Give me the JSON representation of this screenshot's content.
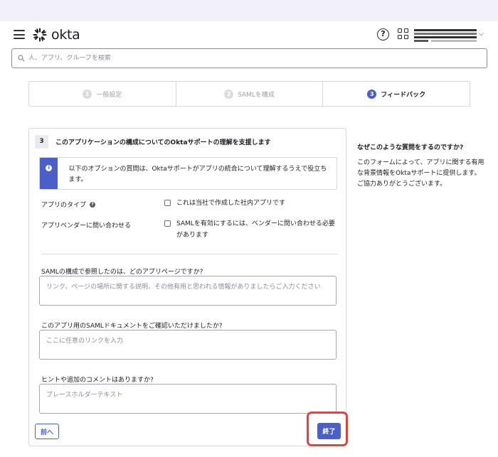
{
  "app": {
    "logo_text": "okta"
  },
  "search": {
    "placeholder": "人、アプリ、グループを検索"
  },
  "steps": [
    {
      "num": "1",
      "label": "一般設定"
    },
    {
      "num": "2",
      "label": "SAMLを構成"
    },
    {
      "num": "3",
      "label": "フィードバック"
    }
  ],
  "card": {
    "number": "3",
    "title": "このアプリケーションの構成についてのOktaサポートの理解を支援します",
    "info_text": "以下のオプションの質問は、Oktaサポートがアプリの統合について理解するうえで役立ちます。",
    "app_type_label": "アプリのタイプ",
    "app_type_option": "これは当社で作成した社内アプリです",
    "vendor_label": "アプリベンダーに問い合わせる",
    "vendor_option": "SAMLを有効にするには、ベンダーに問い合わせる必要があります",
    "q1_label": "SAMLの構成で参照したのは、どのアプリページですか?",
    "q1_placeholder": "リンク、ページの場所に関する説明、その他有用と思われる情報がありましたらご入力ください",
    "q2_label": "このアプリ用のSAMLドキュメントをご確認いただけましたか?",
    "q2_placeholder": "ここに任意のリンクを入力",
    "q3_label": "ヒントや追加のコメントはありますか?",
    "q3_placeholder": "プレースホルダーテキスト",
    "back_label": "前へ",
    "finish_label": "終了"
  },
  "sidebar": {
    "title": "なぜこのような質問をするのですか?",
    "text": "このフォームによって、アプリに関する有用な背景情報をOktaサポートに提供します。ご協力ありがとうございます。"
  },
  "colors": {
    "accent": "#4b5fc8",
    "highlight": "#e2413c"
  }
}
